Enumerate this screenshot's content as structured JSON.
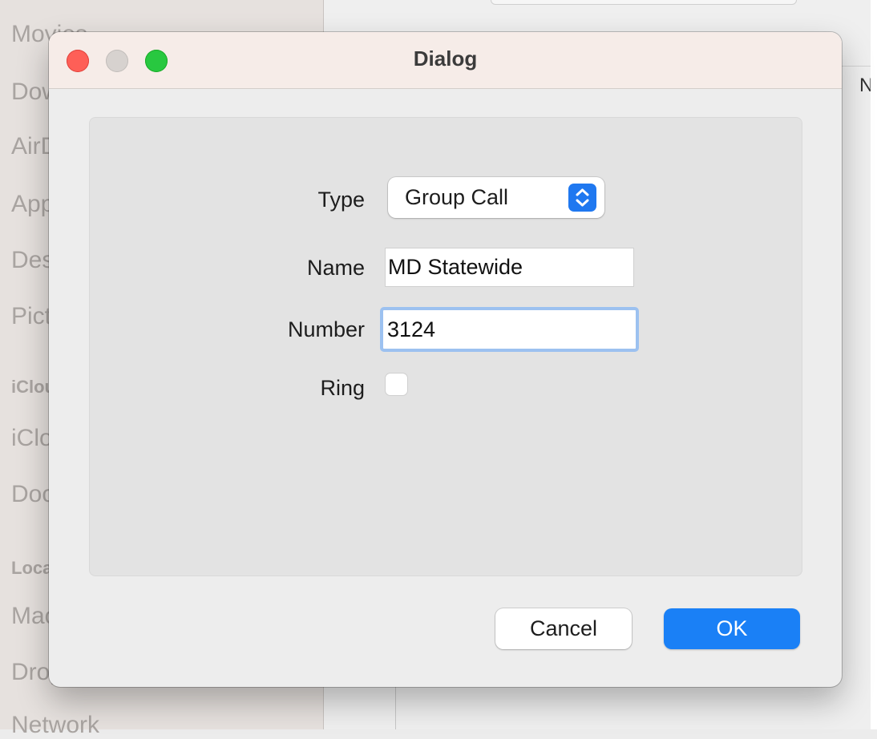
{
  "background": {
    "sidebar_items": [
      "Movies",
      "Downloads",
      "AirDrop",
      "Applications",
      "Desktop",
      "Pictures",
      "iCloud",
      "iCloud Drive",
      "Documents",
      "Locations",
      "Macintosh HD",
      "Dropbox",
      "Network"
    ],
    "column_header": "N"
  },
  "dialog": {
    "title": "Dialog",
    "form": {
      "type_label": "Type",
      "type_value": "Group Call",
      "type_options": [
        "Group Call"
      ],
      "name_label": "Name",
      "name_value": "MD Statewide",
      "number_label": "Number",
      "number_value": "3124",
      "ring_label": "Ring",
      "ring_checked": false
    },
    "buttons": {
      "cancel_label": "Cancel",
      "ok_label": "OK"
    }
  },
  "colors": {
    "accent": "#1a80f6",
    "focus_ring": "#9cc1f0",
    "close": "#fe5f57",
    "zoom": "#28c840"
  },
  "icons": [
    "close-icon",
    "minimize-icon",
    "zoom-icon",
    "up-down-chevron-icon"
  ]
}
